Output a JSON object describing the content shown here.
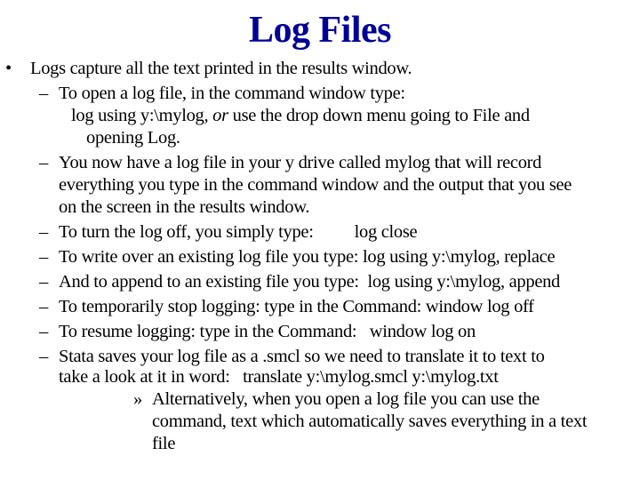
{
  "title": "Log Files",
  "title_color": "#000099",
  "bullets": {
    "level1_marker": "•",
    "level2_marker": "–",
    "level4_marker": "»"
  },
  "items": {
    "main": "Logs capture all the text printed in the results window.",
    "open_log": {
      "line1": "To open a log file, in the command window type:",
      "line2_cmd": "log using y:\\mylog, ",
      "line2_or": "or",
      "line2_rest": " use the drop down menu going to File and",
      "line3": "opening Log."
    },
    "now_have": {
      "line1": "You now have a log file in your y drive called mylog that will record",
      "line2": "everything you type in the command window and the output that you see",
      "line3": "on the screen in the results window."
    },
    "turn_off": {
      "text": "To turn the log off, you simply type:",
      "cmd": "log close"
    },
    "write_over": "To write over an existing log file you type: log using y:\\mylog, replace",
    "append": "And to append to an existing file you type:  log using y:\\mylog, append",
    "stop": "To temporarily stop logging: type in the Command: window log off",
    "resume": "To resume logging: type in the Command:   window log on",
    "smcl": {
      "line1": "Stata saves your log file as a .smcl so we need to translate it to text to",
      "line2": "take a look at it in word:   translate y:\\mylog.smcl y:\\mylog.txt"
    },
    "alternative": {
      "line1": "Alternatively, when you open a log file you can use the",
      "line2": "command, text which automatically saves everything in a text",
      "line3": "file"
    }
  }
}
